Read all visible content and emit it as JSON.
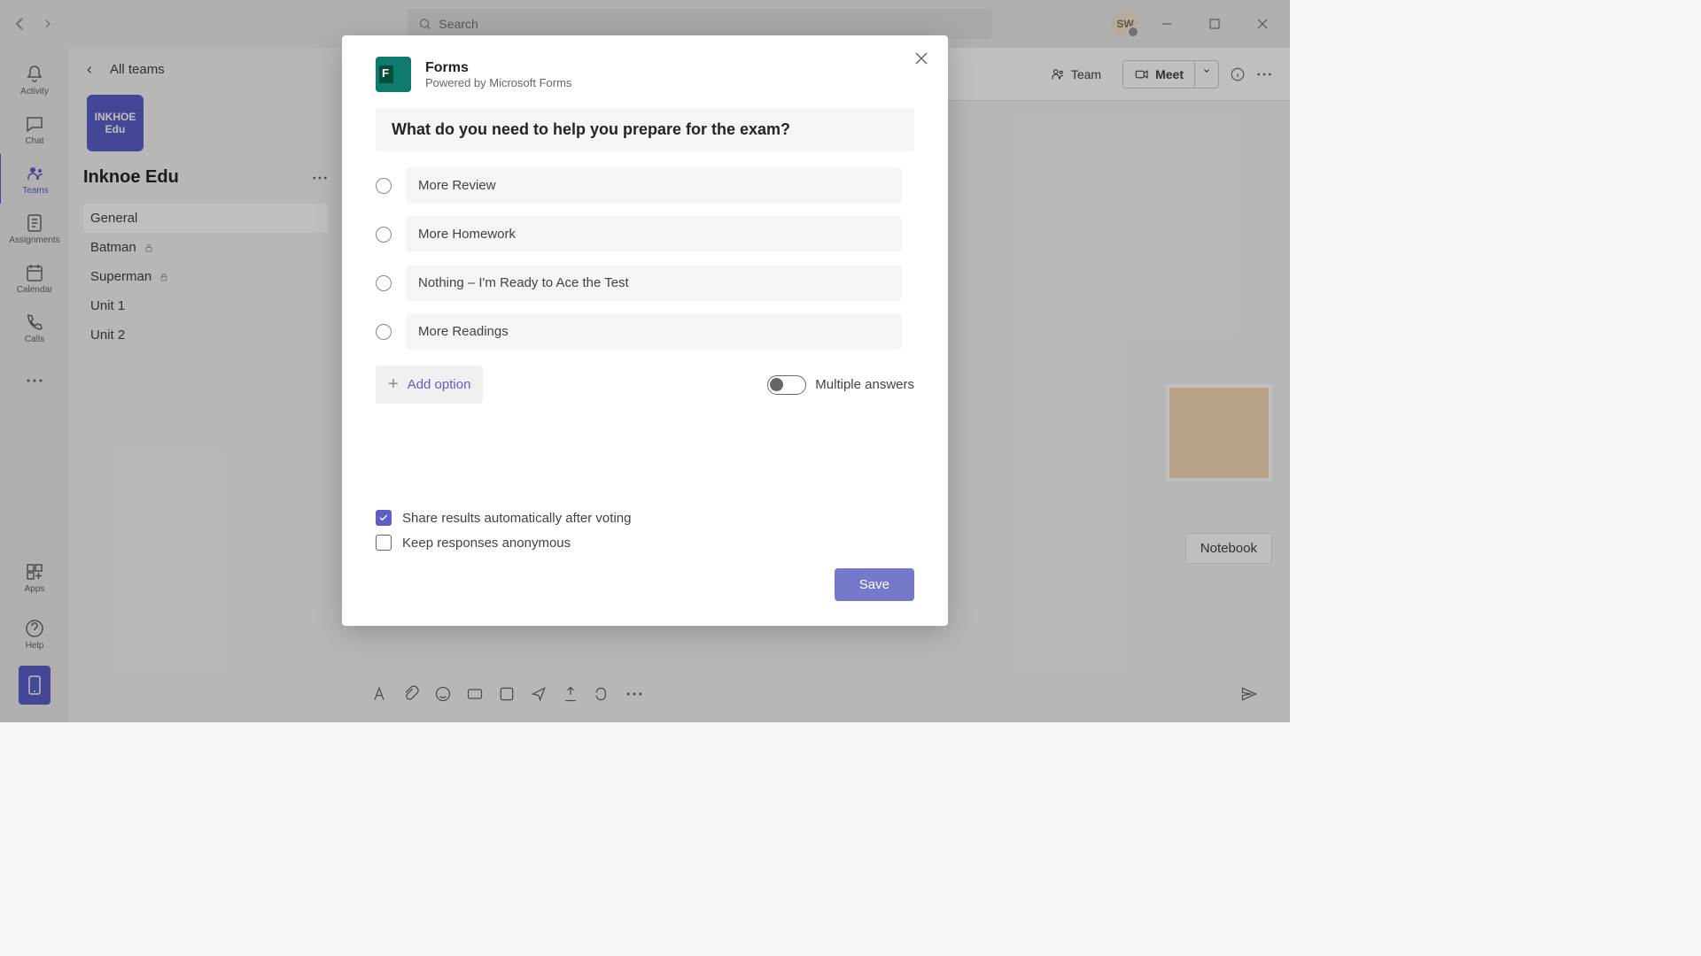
{
  "titlebar": {
    "search_placeholder": "Search",
    "avatar_initials": "SW"
  },
  "rail": {
    "items": [
      {
        "label": "Activity"
      },
      {
        "label": "Chat"
      },
      {
        "label": "Teams"
      },
      {
        "label": "Assignments"
      },
      {
        "label": "Calendar"
      },
      {
        "label": "Calls"
      }
    ],
    "apps_label": "Apps",
    "help_label": "Help"
  },
  "channel_panel": {
    "back_label": "All teams",
    "team_avatar_line1": "INKHOE",
    "team_avatar_line2": "Edu",
    "team_name": "Inknoe Edu",
    "channels": [
      {
        "name": "General",
        "active": true,
        "locked": false
      },
      {
        "name": "Batman",
        "active": false,
        "locked": true
      },
      {
        "name": "Superman",
        "active": false,
        "locked": true
      },
      {
        "name": "Unit 1",
        "active": false,
        "locked": false
      },
      {
        "name": "Unit 2",
        "active": false,
        "locked": false
      }
    ]
  },
  "main_header": {
    "team_label": "Team",
    "meet_label": "Meet"
  },
  "notebook_label": "Notebook",
  "modal": {
    "title": "Forms",
    "subtitle": "Powered by Microsoft Forms",
    "question": "What do you need to help you prepare for the exam?",
    "options": [
      "More Review",
      "More Homework",
      "Nothing – I'm Ready to Ace the Test",
      "More Readings"
    ],
    "add_option_label": "Add option",
    "multiple_answers_label": "Multiple answers",
    "share_results_label": "Share results automatically after voting",
    "anonymous_label": "Keep responses anonymous",
    "save_label": "Save"
  }
}
